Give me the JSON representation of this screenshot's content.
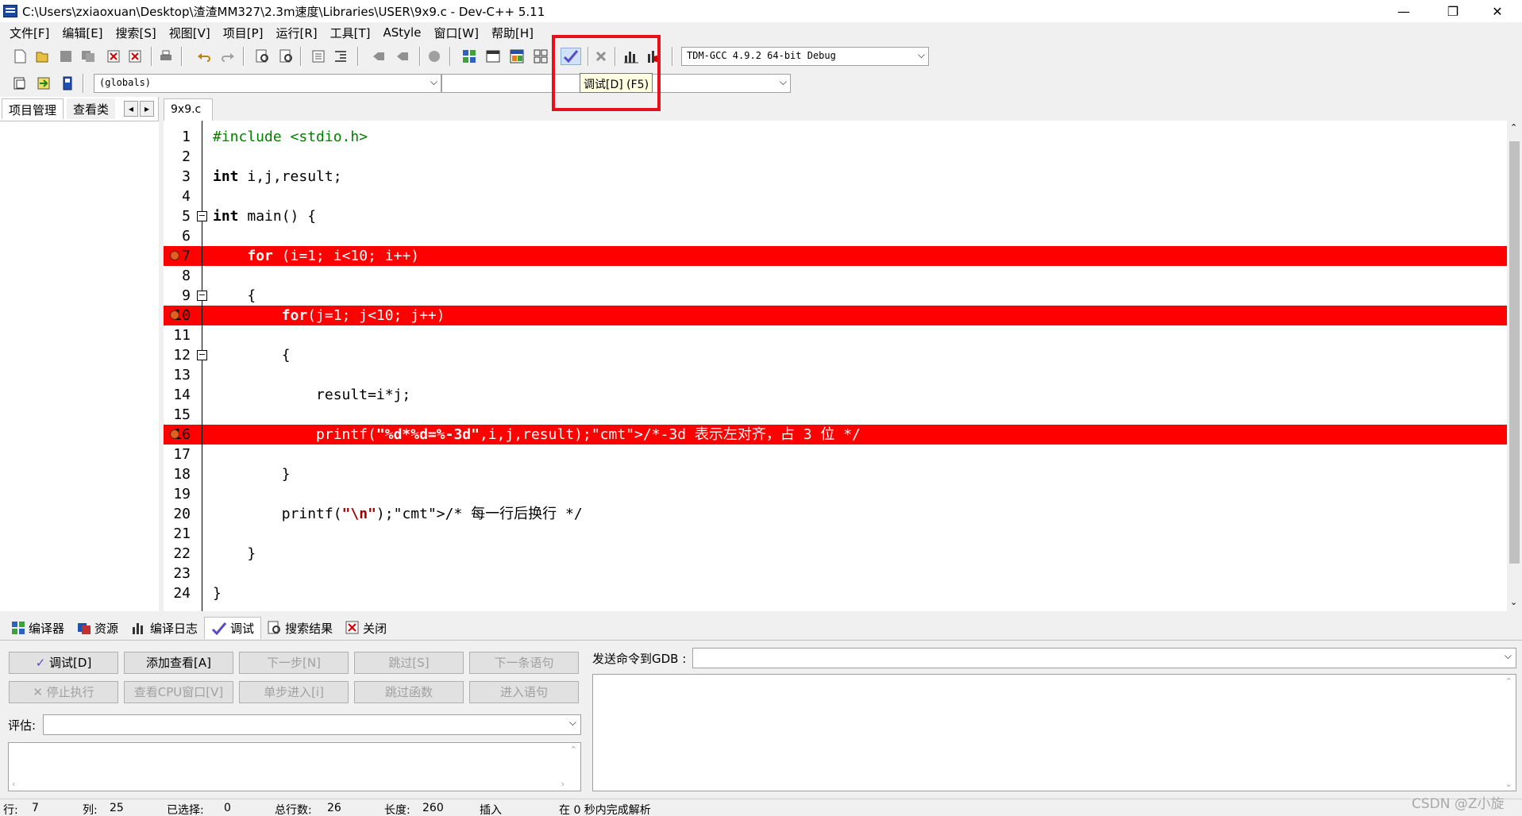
{
  "window": {
    "title": "C:\\Users\\zxiaoxuan\\Desktop\\渣渣MM327\\2.3m速度\\Libraries\\USER\\9x9.c - Dev-C++ 5.11",
    "minimize": "—",
    "restore": "❐",
    "close": "✕"
  },
  "menu": [
    "文件[F]",
    "编辑[E]",
    "搜索[S]",
    "视图[V]",
    "项目[P]",
    "运行[R]",
    "工具[T]",
    "AStyle",
    "窗口[W]",
    "帮助[H]"
  ],
  "toolbar": {
    "compiler_select": "TDM-GCC 4.9.2 64-bit Debug",
    "scope_select": "(globals)",
    "function_select": "",
    "debug_tooltip": "调试[D] (F5)"
  },
  "left_panel": {
    "tabs": [
      "项目管理",
      "查看类"
    ],
    "nav_prev": "◂",
    "nav_next": "▸"
  },
  "editor": {
    "file_tab": "9x9.c",
    "lines": [
      {
        "n": "1",
        "code": "#include <stdio.h>"
      },
      {
        "n": "2",
        "code": ""
      },
      {
        "n": "3",
        "code": "int i,j,result;"
      },
      {
        "n": "4",
        "code": ""
      },
      {
        "n": "5",
        "code": "int main() {"
      },
      {
        "n": "6",
        "code": ""
      },
      {
        "n": "7",
        "code": "    for (i=1; i<10; i++)",
        "breakpoint": true
      },
      {
        "n": "8",
        "code": ""
      },
      {
        "n": "9",
        "code": "    {"
      },
      {
        "n": "10",
        "code": "        for(j=1; j<10; j++)",
        "breakpoint": true
      },
      {
        "n": "11",
        "code": ""
      },
      {
        "n": "12",
        "code": "        {"
      },
      {
        "n": "13",
        "code": ""
      },
      {
        "n": "14",
        "code": "            result=i*j;"
      },
      {
        "n": "15",
        "code": ""
      },
      {
        "n": "16",
        "code": "            printf(\"%d*%d=%-3d\",i,j,result);/*-3d 表示左对齐，占 3 位 */",
        "breakpoint": true
      },
      {
        "n": "17",
        "code": ""
      },
      {
        "n": "18",
        "code": "        }"
      },
      {
        "n": "19",
        "code": ""
      },
      {
        "n": "20",
        "code": "        printf(\"\\n\");/* 每一行后换行 */"
      },
      {
        "n": "21",
        "code": ""
      },
      {
        "n": "22",
        "code": "    }"
      },
      {
        "n": "23",
        "code": ""
      },
      {
        "n": "24",
        "code": "}"
      }
    ]
  },
  "bottom_tabs": [
    "编译器",
    "资源",
    "编译日志",
    "调试",
    "搜索结果",
    "关闭"
  ],
  "debug_panel": {
    "buttons_row1": [
      "调试[D]",
      "添加查看[A]",
      "下一步[N]",
      "跳过[S]",
      "下一条语句"
    ],
    "buttons_row2": [
      "停止执行",
      "查看CPU窗口[V]",
      "单步进入[i]",
      "跳过函数",
      "进入语句"
    ],
    "evaluate_label": "评估:",
    "evaluate_value": "",
    "gdb_label": "发送命令到GDB :",
    "gdb_value": ""
  },
  "status": {
    "row_label": "行:",
    "row_value": "7",
    "col_label": "列:",
    "col_value": "25",
    "sel_label": "已选择:",
    "sel_value": "0",
    "total_label": "总行数:",
    "total_value": "26",
    "len_label": "长度:",
    "len_value": "260",
    "mode": "插入",
    "parse": "在 0 秒内完成解析"
  },
  "watermark": "CSDN @Z小旋",
  "colors": {
    "breakpoint_line": "#ff0000",
    "annotation_box": "#e8101c",
    "comment": "#1a8ae0",
    "preprocessor": "#008000"
  }
}
